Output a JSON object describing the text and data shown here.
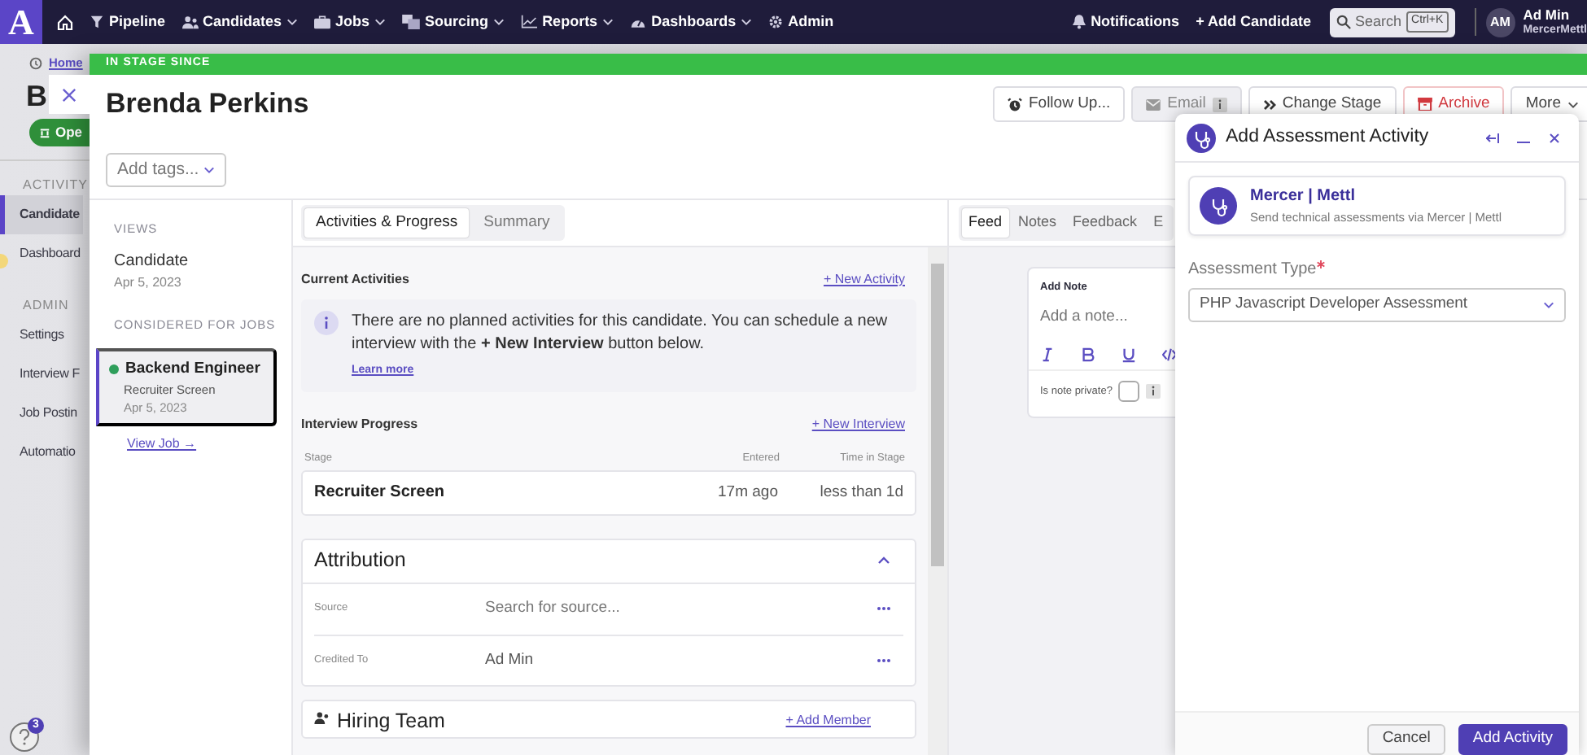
{
  "navbar": {
    "logo": "A",
    "items": [
      {
        "label": "Pipeline",
        "dropdown": false
      },
      {
        "label": "Candidates",
        "dropdown": true
      },
      {
        "label": "Jobs",
        "dropdown": true
      },
      {
        "label": "Sourcing",
        "dropdown": true
      },
      {
        "label": "Reports",
        "dropdown": true
      },
      {
        "label": "Dashboards",
        "dropdown": true
      },
      {
        "label": "Admin",
        "dropdown": false
      }
    ],
    "notifications": "Notifications",
    "add_candidate": "+ Add Candidate",
    "search": {
      "placeholder": "Search",
      "shortcut": "Ctrl+K"
    },
    "user": {
      "initials": "AM",
      "name": "Ad Min",
      "org": "MercerMettl"
    }
  },
  "background_page": {
    "breadcrumb": "Home",
    "title": "B",
    "status_button": "Ope",
    "sidebar": [
      {
        "heading": "ACTIVITY",
        "items": [
          {
            "label": "Candidate",
            "selected": true
          },
          {
            "label": "Dashboard",
            "selected": false
          }
        ]
      },
      {
        "heading": "ADMIN",
        "items": [
          {
            "label": "Settings",
            "selected": false
          },
          {
            "label": "Interview F",
            "selected": false
          },
          {
            "label": "Job Postin",
            "selected": false
          },
          {
            "label": "Automatio",
            "selected": false
          }
        ]
      }
    ],
    "help_badge": "3"
  },
  "drawer": {
    "banner": "IN STAGE SINCE",
    "name": "Brenda Perkins",
    "actions": [
      {
        "label": "Follow Up...",
        "kind": "default"
      },
      {
        "label": "Email",
        "kind": "muted"
      },
      {
        "label": "Change Stage",
        "kind": "default"
      },
      {
        "label": "Archive",
        "kind": "danger"
      },
      {
        "label": "More",
        "kind": "dropdown"
      }
    ],
    "tags": {
      "placeholder": "Add tags..."
    },
    "views": {
      "heading": "VIEWS",
      "items": [
        {
          "title": "Candidate",
          "date": "Apr 5, 2023"
        }
      ]
    },
    "jobs": {
      "heading": "CONSIDERED FOR JOBS",
      "items": [
        {
          "title": "Backend Engineer",
          "stage": "Recruiter Screen",
          "date": "Apr 5, 2023",
          "selected": true,
          "color": "#2e9e5b"
        }
      ],
      "link": "View Job →"
    }
  },
  "activity_tabs": [
    {
      "label": "Activities & Progress",
      "selected": true
    },
    {
      "label": "Summary",
      "selected": false
    }
  ],
  "current_activities": {
    "heading": "Current Activities",
    "action": "+ New Activity",
    "message": "There are no planned activities for this candidate. You can schedule a new interview with the **+ New Interview** button below.",
    "link": "Learn more"
  },
  "interview_progress": {
    "heading": "Interview Progress",
    "action": "+ New Interview",
    "columns": [
      "Stage",
      "Entered",
      "Time in Stage"
    ],
    "rows": [
      {
        "stage": "Recruiter Screen",
        "entered": "17m ago",
        "time_in_stage": "less than 1d"
      }
    ]
  },
  "attribution": {
    "title": "Attribution",
    "expanded": true,
    "fields": [
      {
        "label": "Source",
        "placeholder": "Search for source..."
      },
      {
        "label": "Credited To",
        "value": "Ad Min"
      }
    ]
  },
  "hiring_team": {
    "title": "Hiring Team",
    "action": "+ Add Member"
  },
  "feed_tabs": [
    {
      "label": "Feed",
      "selected": true
    },
    {
      "label": "Notes",
      "selected": false
    },
    {
      "label": "Feedback",
      "selected": false
    },
    {
      "label": "E",
      "selected": false
    }
  ],
  "note": {
    "label": "Add Note",
    "placeholder": "Add a note...",
    "private_label": "Is note private?",
    "private": false
  },
  "modal": {
    "title": "Add Assessment Activity",
    "provider": {
      "name": "Mercer | Mettl",
      "description": "Send technical assessments via Mercer | Mettl"
    },
    "field": {
      "label": "Assessment Type",
      "required": true,
      "value": "PHP Javascript Developer Assessment"
    },
    "buttons": [
      {
        "label": "Cancel",
        "kind": "secondary"
      },
      {
        "label": "Add Activity",
        "kind": "primary"
      }
    ]
  }
}
